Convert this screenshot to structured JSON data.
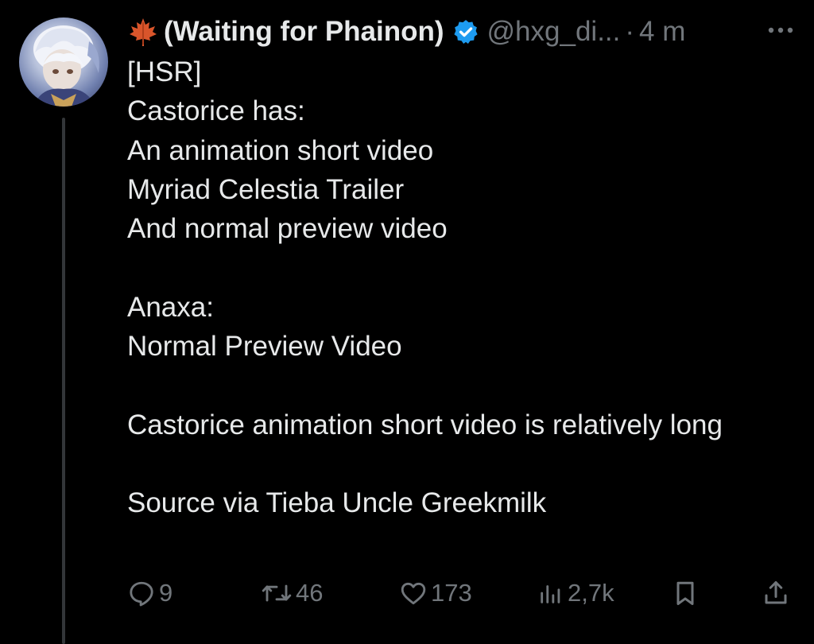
{
  "author": {
    "display_name": "(Waiting for Phainon)",
    "handle": "@hxg_di...",
    "separator": "·",
    "time": "4 m",
    "emoji_icon": "maple-leaf-icon",
    "verified": true,
    "accent_color": "#1d9bf0"
  },
  "tweet": {
    "text": "[HSR]\nCastorice has:\nAn animation short video\nMyriad Celestia Trailer\nAnd normal preview video\n\nAnaxa:\nNormal Preview Video\n\nCastorice animation short video is relatively long\n\nSource via Tieba Uncle Greekmilk"
  },
  "actions": {
    "reply": {
      "icon": "reply-icon",
      "count": "9"
    },
    "retweet": {
      "icon": "retweet-icon",
      "count": "46"
    },
    "like": {
      "icon": "heart-icon",
      "count": "173"
    },
    "views": {
      "icon": "views-icon",
      "count": "2,7k"
    },
    "bookmark": {
      "icon": "bookmark-icon"
    },
    "share": {
      "icon": "share-icon"
    }
  },
  "colors": {
    "background": "#000000",
    "text_primary": "#e7e9ea",
    "text_secondary": "#71767b",
    "thread_line": "#333639"
  }
}
